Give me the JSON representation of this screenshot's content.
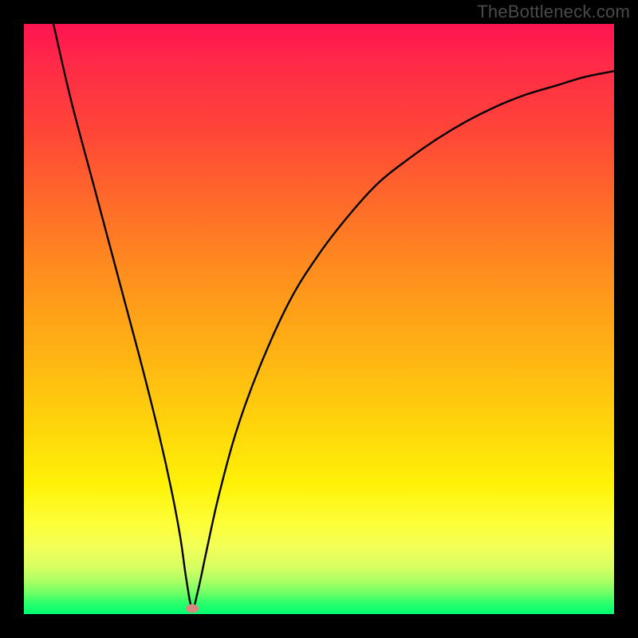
{
  "watermark_text": "TheBottleneck.com",
  "chart_data": {
    "type": "line",
    "title": "",
    "xlabel": "",
    "ylabel": "",
    "xlim": [
      0,
      100
    ],
    "ylim": [
      0,
      100
    ],
    "grid": false,
    "legend": null,
    "series": [
      {
        "name": "bottleneck-curve",
        "x": [
          5,
          8,
          12,
          16,
          20,
          23,
          25,
          26.5,
          27.5,
          28.5,
          29.5,
          31,
          33,
          36,
          40,
          45,
          50,
          55,
          60,
          65,
          70,
          75,
          80,
          85,
          90,
          95,
          100
        ],
        "y": [
          100,
          87,
          72,
          57,
          42,
          30,
          21,
          13,
          6,
          1,
          4,
          11,
          20,
          31,
          42,
          53,
          61,
          67.5,
          73,
          77,
          80.5,
          83.5,
          86,
          88,
          89.5,
          91,
          92
        ]
      }
    ],
    "background_gradient": {
      "top": "#ff1450",
      "upper_mid": "#ff8e1e",
      "mid": "#ffd40c",
      "lower_mid": "#fcff3a",
      "bottom": "#00ff70"
    },
    "marker": {
      "x": 28.5,
      "y": 1,
      "color": "#d9867f"
    }
  }
}
